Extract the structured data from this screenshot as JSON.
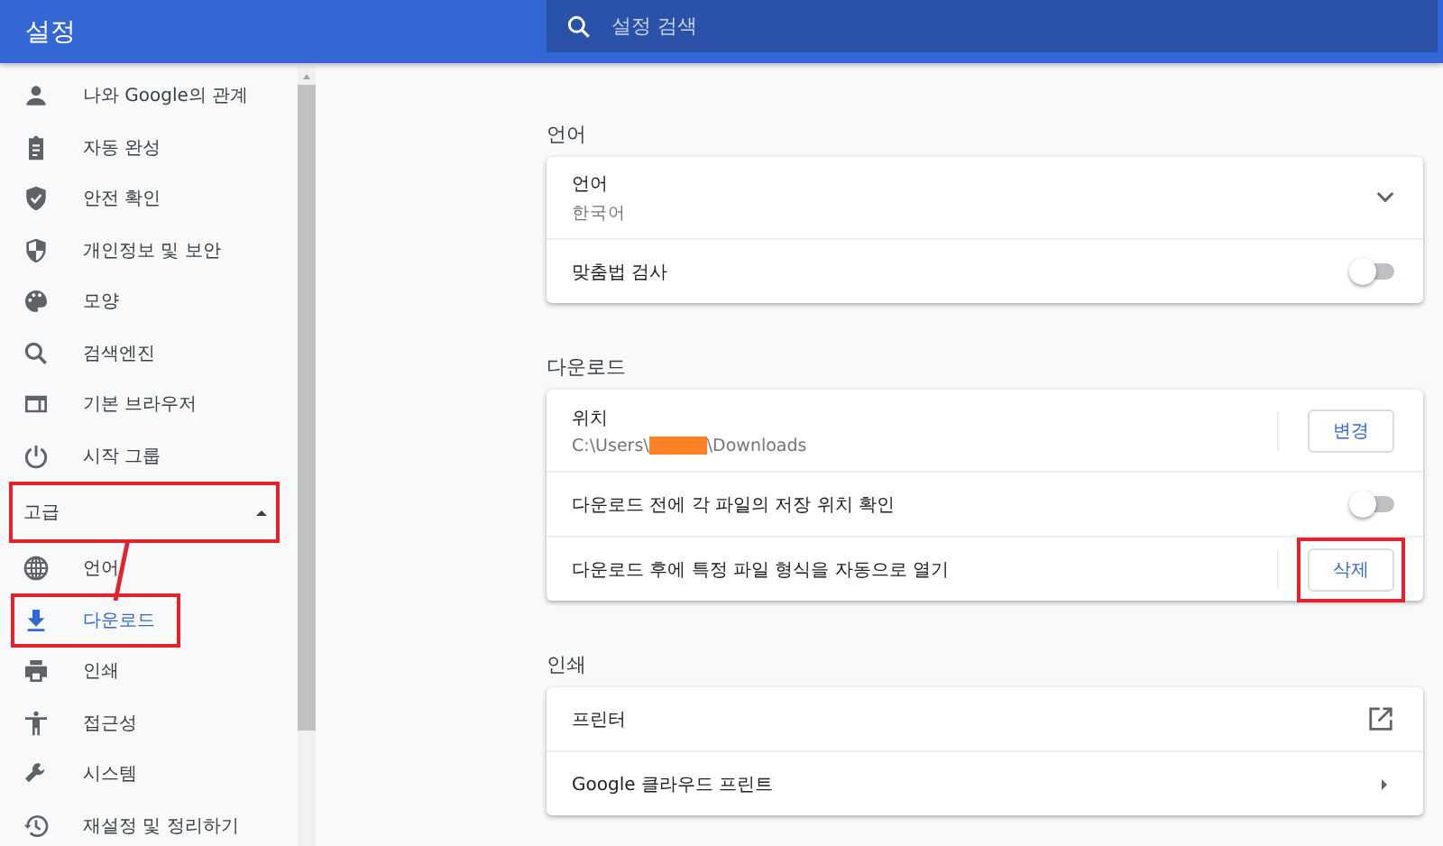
{
  "header": {
    "title": "설정",
    "search": {
      "placeholder": "설정 검색"
    }
  },
  "sidebar": {
    "items": [
      {
        "label": "나와 Google의 관계",
        "selected": false,
        "highlighted": false
      },
      {
        "label": "자동 완성",
        "selected": false,
        "highlighted": false
      },
      {
        "label": "안전 확인",
        "selected": false,
        "highlighted": false
      },
      {
        "label": "개인정보 및 보안",
        "selected": false,
        "highlighted": false
      },
      {
        "label": "모양",
        "selected": false,
        "highlighted": false
      },
      {
        "label": "검색엔진",
        "selected": false,
        "highlighted": false
      },
      {
        "label": "기본 브라우저",
        "selected": false,
        "highlighted": false
      },
      {
        "label": "시작 그룹",
        "selected": false,
        "highlighted": false
      }
    ],
    "advanced": {
      "label": "고급",
      "expanded": true,
      "highlighted": true
    },
    "advanced_items": [
      {
        "label": "언어",
        "selected": false,
        "highlighted": false
      },
      {
        "label": "다운로드",
        "selected": true,
        "highlighted": true
      },
      {
        "label": "인쇄",
        "selected": false,
        "highlighted": false
      },
      {
        "label": "접근성",
        "selected": false,
        "highlighted": false
      },
      {
        "label": "시스템",
        "selected": false,
        "highlighted": false
      },
      {
        "label": "재설정 및 정리하기",
        "selected": false,
        "highlighted": false
      }
    ]
  },
  "sections": [
    {
      "title": "언어",
      "rows": [
        {
          "kind": "dropdown",
          "label": "언어",
          "value": "한국어"
        },
        {
          "kind": "toggle",
          "label": "맞춤법 검사",
          "on": false
        }
      ]
    },
    {
      "title": "다운로드",
      "rows": [
        {
          "kind": "path",
          "label": "위치",
          "path_start": "C:\\Users\\",
          "path_end": "\\Downloads",
          "button": "변경",
          "highlighted": false
        },
        {
          "kind": "toggle",
          "label": "다운로드 전에 각 파일의 저장 위치 확인",
          "on": false
        },
        {
          "kind": "button",
          "label": "다운로드 후에 특정 파일 형식을 자동으로 열기",
          "button": "삭제",
          "highlighted": true
        }
      ]
    },
    {
      "title": "인쇄",
      "rows": [
        {
          "kind": "external",
          "label": "프린터"
        },
        {
          "kind": "arrow",
          "label": "Google 클라우드 프린트"
        }
      ]
    }
  ]
}
